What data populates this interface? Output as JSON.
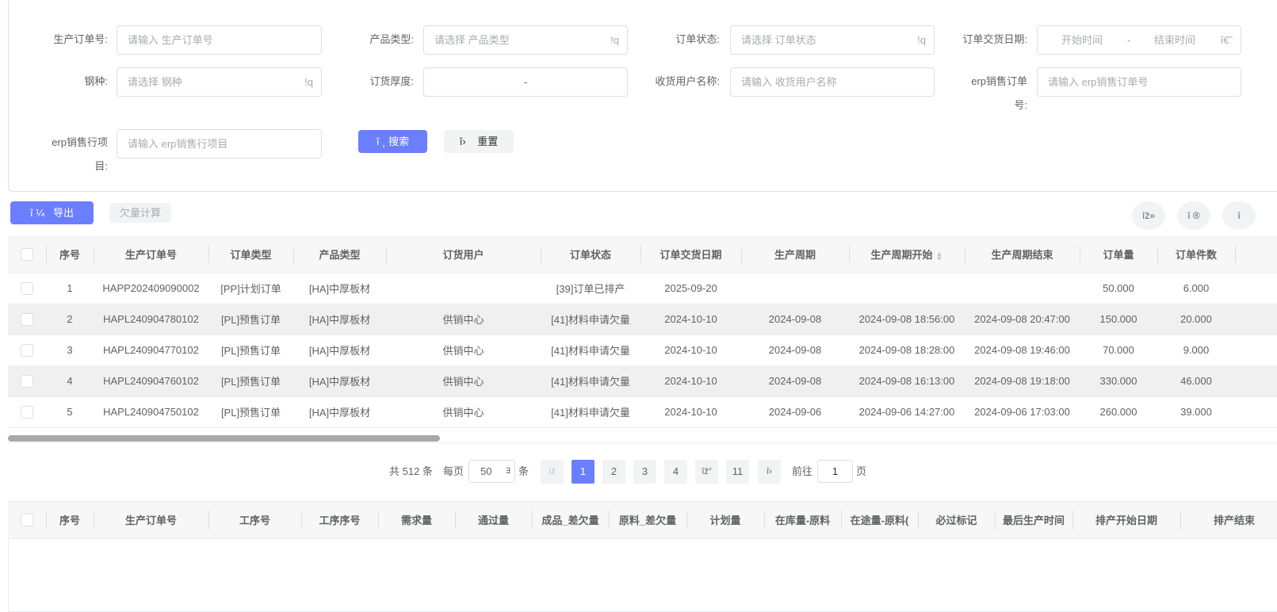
{
  "filters": {
    "order_no": {
      "label": "生产订单号:",
      "placeholder": "请输入 生产订单号"
    },
    "product_type": {
      "label": "产品类型:",
      "placeholder": "请选择 产品类型",
      "suffix": "!q"
    },
    "order_status": {
      "label": "订单状态:",
      "placeholder": "请选择 订单状态",
      "suffix": "!q"
    },
    "delivery_date": {
      "label": "订单交货日期:",
      "start": "开始时间",
      "sep": "-",
      "end": "结束时间",
      "suffix": "î€˜"
    },
    "steel": {
      "label": "钢种:",
      "placeholder": "请选择 钢种",
      "suffix": "!q"
    },
    "thickness": {
      "label": "订货厚度:",
      "sep": "-"
    },
    "receiver": {
      "label": "收货用户名称:",
      "placeholder": "请输入 收货用户名称"
    },
    "erp_order": {
      "label1": "erp销售订单",
      "label2": "号:",
      "placeholder": "请输入 erp销售订单号"
    },
    "erp_line": {
      "label1": "erp销售行项",
      "label2": "目:",
      "placeholder": "请输入 erp销售行项目"
    },
    "search_icon": "î  ¸",
    "search": "搜索",
    "reset_icon": "î›",
    "reset": "重置"
  },
  "toolbar": {
    "export_icon": "î  ¼",
    "export": "导出",
    "shortage": "欠量计算",
    "right_icons": [
      "îž»",
      "î  ®",
      "î"
    ]
  },
  "table": {
    "headers": [
      "序号",
      "生产订单号",
      "订单类型",
      "产品类型",
      "订货用户",
      "订单状态",
      "订单交货日期",
      "生产周期",
      "生产周期开始",
      "生产周期结束",
      "订单量",
      "订单件数",
      ""
    ],
    "rows": [
      [
        "1",
        "HAPP202409090002",
        "[PP]计划订单",
        "[HA]中厚板材",
        "",
        "[39]订单已排产",
        "2025-09-20",
        "",
        "",
        "",
        "50.000",
        "6.000",
        ""
      ],
      [
        "2",
        "HAPL240904780102",
        "[PL]预售订单",
        "[HA]中厚板材",
        "供销中心",
        "[41]材料申请欠量",
        "2024-10-10",
        "2024-09-08",
        "2024-09-08 18:56:00",
        "2024-09-08 20:47:00",
        "150.000",
        "20.000",
        ""
      ],
      [
        "3",
        "HAPL240904770102",
        "[PL]预售订单",
        "[HA]中厚板材",
        "供销中心",
        "[41]材料申请欠量",
        "2024-10-10",
        "2024-09-08",
        "2024-09-08 18:28:00",
        "2024-09-08 19:46:00",
        "70.000",
        "9.000",
        ""
      ],
      [
        "4",
        "HAPL240904760102",
        "[PL]预售订单",
        "[HA]中厚板材",
        "供销中心",
        "[41]材料申请欠量",
        "2024-10-10",
        "2024-09-08",
        "2024-09-08 16:13:00",
        "2024-09-08 19:18:00",
        "330.000",
        "46.000",
        ""
      ],
      [
        "5",
        "HAPL240904750102",
        "[PL]预售订单",
        "[HA]中厚板材",
        "供销中心",
        "[41]材料申请欠量",
        "2024-10-10",
        "2024-09-06",
        "2024-09-06 14:27:00",
        "2024-09-06 17:03:00",
        "260.000",
        "39.000",
        ""
      ]
    ]
  },
  "pagination": {
    "total": "共 512 条",
    "per_page_label": "每页",
    "per_page": "50",
    "per_page_icon": "∃",
    "unit": "条",
    "prev": "îž",
    "pages": [
      "1",
      "2",
      "3",
      "4"
    ],
    "more": "îž”",
    "last": "11",
    "next": "î›",
    "goto": "前往",
    "goto_value": "1",
    "page_unit": "页"
  },
  "detail_table": {
    "headers": [
      "序号",
      "生产订单号",
      "工序号",
      "工序序号",
      "需求量",
      "通过量",
      "成品_差欠量",
      "原料_差欠量",
      "计划量",
      "在库量-原料",
      "在途量-原料(",
      "必过标记",
      "最后生产时间",
      "排产开始日期",
      "排产结束"
    ]
  }
}
